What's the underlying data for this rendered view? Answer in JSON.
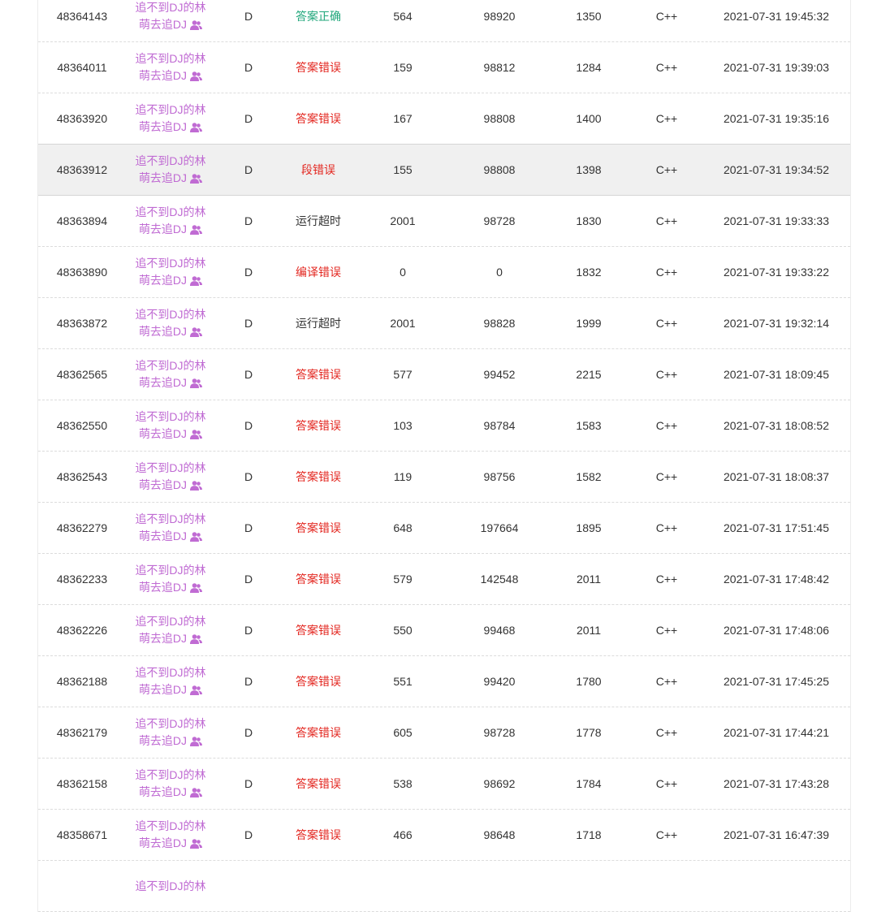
{
  "colors": {
    "user": "#c06bd3",
    "accepted": "#1fa67a",
    "error": "#e3261f",
    "neutral": "#333333"
  },
  "rows": [
    {
      "id": "48364143",
      "user_line1": "追不到DJ的林",
      "user_line2": "萌去追DJ",
      "problem": "D",
      "result": "答案正确",
      "result_type": "ok",
      "time": "564",
      "memory": "98920",
      "length": "1350",
      "language": "C++",
      "submitted": "2021-07-31 19:45:32"
    },
    {
      "id": "48364011",
      "user_line1": "追不到DJ的林",
      "user_line2": "萌去追DJ",
      "problem": "D",
      "result": "答案错误",
      "result_type": "err",
      "time": "159",
      "memory": "98812",
      "length": "1284",
      "language": "C++",
      "submitted": "2021-07-31 19:39:03"
    },
    {
      "id": "48363920",
      "user_line1": "追不到DJ的林",
      "user_line2": "萌去追DJ",
      "problem": "D",
      "result": "答案错误",
      "result_type": "err",
      "time": "167",
      "memory": "98808",
      "length": "1400",
      "language": "C++",
      "submitted": "2021-07-31 19:35:16"
    },
    {
      "id": "48363912",
      "user_line1": "追不到DJ的林",
      "user_line2": "萌去追DJ",
      "problem": "D",
      "result": "段错误",
      "result_type": "err",
      "time": "155",
      "memory": "98808",
      "length": "1398",
      "language": "C++",
      "submitted": "2021-07-31 19:34:52",
      "hover": true
    },
    {
      "id": "48363894",
      "user_line1": "追不到DJ的林",
      "user_line2": "萌去追DJ",
      "problem": "D",
      "result": "运行超时",
      "result_type": "tle",
      "time": "2001",
      "memory": "98728",
      "length": "1830",
      "language": "C++",
      "submitted": "2021-07-31 19:33:33"
    },
    {
      "id": "48363890",
      "user_line1": "追不到DJ的林",
      "user_line2": "萌去追DJ",
      "problem": "D",
      "result": "编译错误",
      "result_type": "err",
      "time": "0",
      "memory": "0",
      "length": "1832",
      "language": "C++",
      "submitted": "2021-07-31 19:33:22"
    },
    {
      "id": "48363872",
      "user_line1": "追不到DJ的林",
      "user_line2": "萌去追DJ",
      "problem": "D",
      "result": "运行超时",
      "result_type": "tle",
      "time": "2001",
      "memory": "98828",
      "length": "1999",
      "language": "C++",
      "submitted": "2021-07-31 19:32:14"
    },
    {
      "id": "48362565",
      "user_line1": "追不到DJ的林",
      "user_line2": "萌去追DJ",
      "problem": "D",
      "result": "答案错误",
      "result_type": "err",
      "time": "577",
      "memory": "99452",
      "length": "2215",
      "language": "C++",
      "submitted": "2021-07-31 18:09:45"
    },
    {
      "id": "48362550",
      "user_line1": "追不到DJ的林",
      "user_line2": "萌去追DJ",
      "problem": "D",
      "result": "答案错误",
      "result_type": "err",
      "time": "103",
      "memory": "98784",
      "length": "1583",
      "language": "C++",
      "submitted": "2021-07-31 18:08:52"
    },
    {
      "id": "48362543",
      "user_line1": "追不到DJ的林",
      "user_line2": "萌去追DJ",
      "problem": "D",
      "result": "答案错误",
      "result_type": "err",
      "time": "119",
      "memory": "98756",
      "length": "1582",
      "language": "C++",
      "submitted": "2021-07-31 18:08:37"
    },
    {
      "id": "48362279",
      "user_line1": "追不到DJ的林",
      "user_line2": "萌去追DJ",
      "problem": "D",
      "result": "答案错误",
      "result_type": "err",
      "time": "648",
      "memory": "197664",
      "length": "1895",
      "language": "C++",
      "submitted": "2021-07-31 17:51:45"
    },
    {
      "id": "48362233",
      "user_line1": "追不到DJ的林",
      "user_line2": "萌去追DJ",
      "problem": "D",
      "result": "答案错误",
      "result_type": "err",
      "time": "579",
      "memory": "142548",
      "length": "2011",
      "language": "C++",
      "submitted": "2021-07-31 17:48:42"
    },
    {
      "id": "48362226",
      "user_line1": "追不到DJ的林",
      "user_line2": "萌去追DJ",
      "problem": "D",
      "result": "答案错误",
      "result_type": "err",
      "time": "550",
      "memory": "99468",
      "length": "2011",
      "language": "C++",
      "submitted": "2021-07-31 17:48:06"
    },
    {
      "id": "48362188",
      "user_line1": "追不到DJ的林",
      "user_line2": "萌去追DJ",
      "problem": "D",
      "result": "答案错误",
      "result_type": "err",
      "time": "551",
      "memory": "99420",
      "length": "1780",
      "language": "C++",
      "submitted": "2021-07-31 17:45:25"
    },
    {
      "id": "48362179",
      "user_line1": "追不到DJ的林",
      "user_line2": "萌去追DJ",
      "problem": "D",
      "result": "答案错误",
      "result_type": "err",
      "time": "605",
      "memory": "98728",
      "length": "1778",
      "language": "C++",
      "submitted": "2021-07-31 17:44:21"
    },
    {
      "id": "48362158",
      "user_line1": "追不到DJ的林",
      "user_line2": "萌去追DJ",
      "problem": "D",
      "result": "答案错误",
      "result_type": "err",
      "time": "538",
      "memory": "98692",
      "length": "1784",
      "language": "C++",
      "submitted": "2021-07-31 17:43:28"
    },
    {
      "id": "48358671",
      "user_line1": "追不到DJ的林",
      "user_line2": "萌去追DJ",
      "problem": "D",
      "result": "答案错误",
      "result_type": "err",
      "time": "466",
      "memory": "98648",
      "length": "1718",
      "language": "C++",
      "submitted": "2021-07-31 16:47:39"
    },
    {
      "id": "",
      "user_line1": "追不到DJ的林",
      "user_line2": "",
      "problem": "",
      "result": "",
      "result_type": "err",
      "time": "",
      "memory": "",
      "length": "",
      "language": "",
      "submitted": ""
    }
  ]
}
